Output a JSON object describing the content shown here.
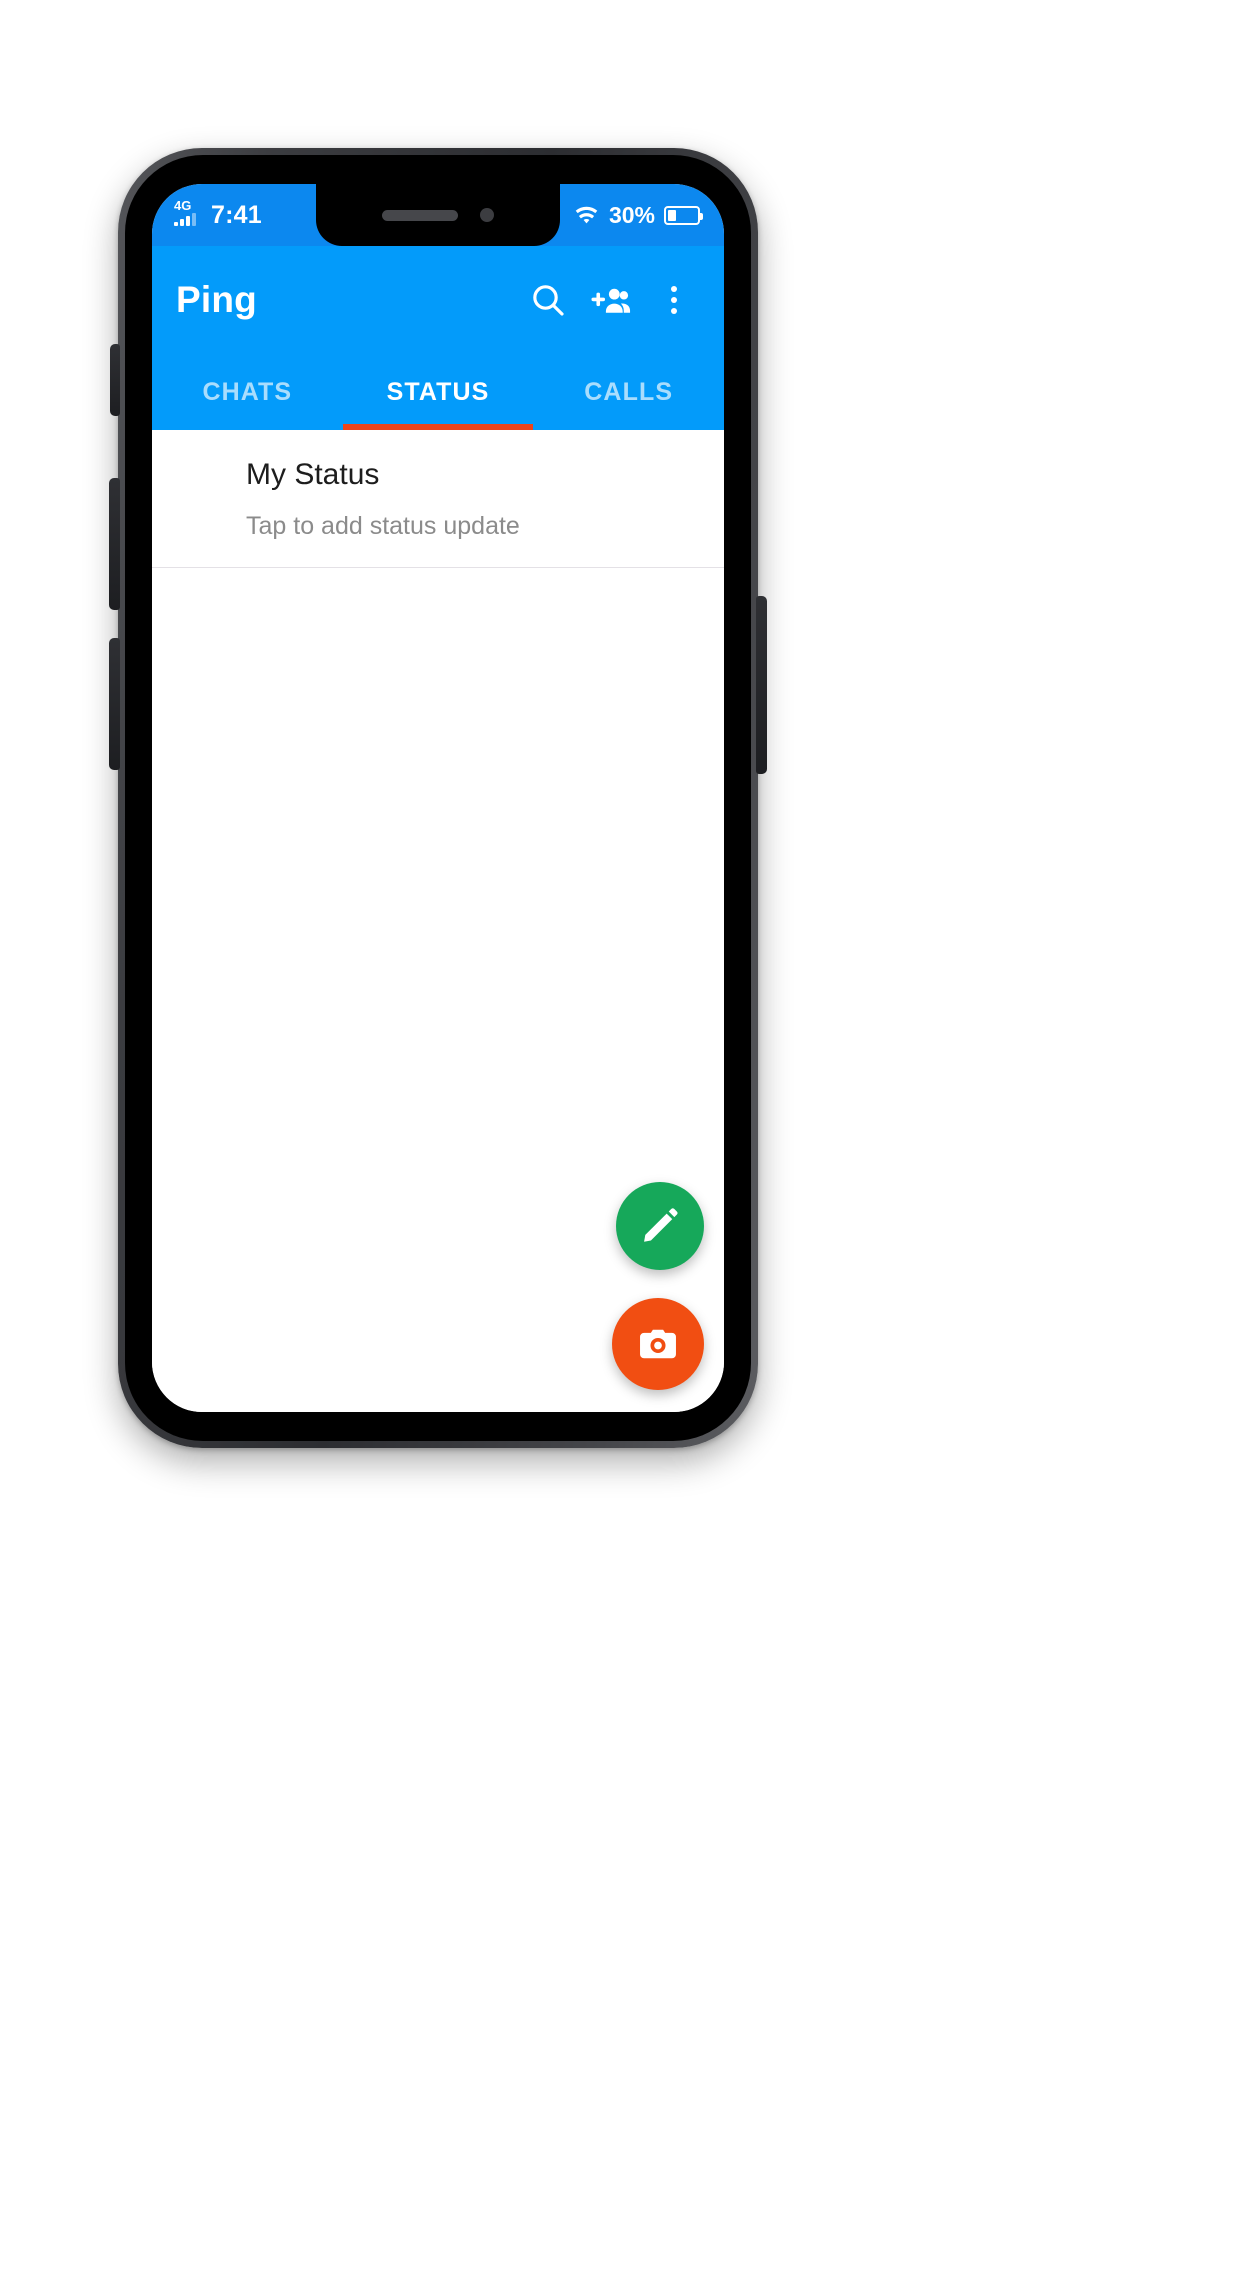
{
  "app": {
    "title": "Ping",
    "accent_blue": "#039bfa",
    "statusbar_blue": "#0c88ef",
    "tab_indicator_orange": "#ec4419",
    "fab_edit_green": "#16a85a",
    "fab_camera_orange": "#f14e12"
  },
  "statusbar": {
    "network_label": "4G",
    "time": "7:41",
    "battery_percent": "30%",
    "battery_level_pct": 30,
    "signal_icon": "signal-bars-icon",
    "wifi_icon": "wifi-icon",
    "battery_icon": "battery-icon"
  },
  "appbar": {
    "title": "Ping",
    "actions": [
      {
        "name": "search-icon",
        "label": "Search"
      },
      {
        "name": "add-people-icon",
        "label": "New group"
      },
      {
        "name": "overflow-menu-icon",
        "label": "More options"
      }
    ]
  },
  "tabs": {
    "items": [
      {
        "label": "CHATS",
        "active": false
      },
      {
        "label": "STATUS",
        "active": true
      },
      {
        "label": "CALLS",
        "active": false
      }
    ],
    "active_index": 1
  },
  "content": {
    "my_status": {
      "title": "My Status",
      "subtitle": "Tap to add status update"
    }
  },
  "fabs": [
    {
      "name": "edit-fab",
      "icon": "pencil-icon",
      "color": "#16a85a"
    },
    {
      "name": "camera-fab",
      "icon": "camera-icon",
      "color": "#f14e12"
    }
  ]
}
